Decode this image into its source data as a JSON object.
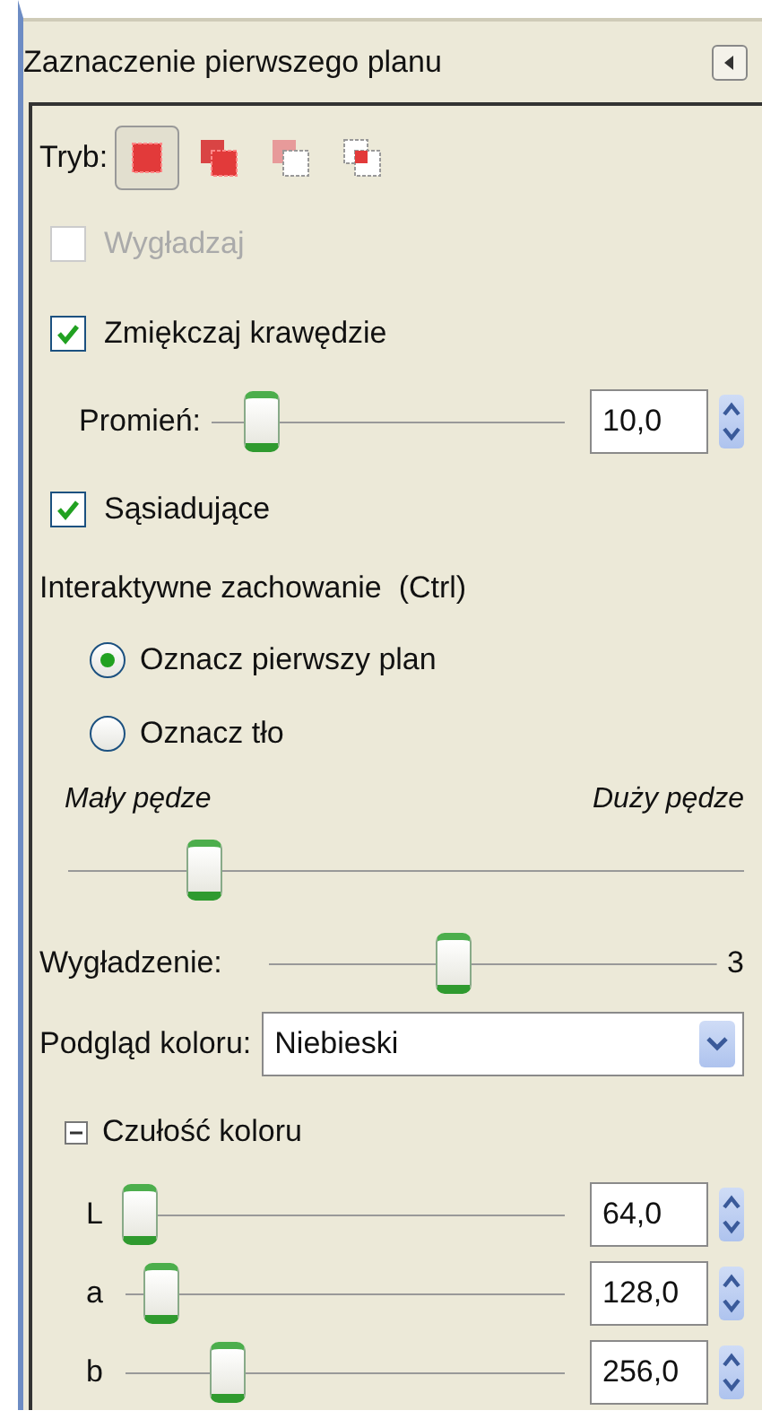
{
  "panel": {
    "title": "Zaznaczenie pierwszego planu"
  },
  "mode": {
    "label": "Tryb:",
    "options": [
      {
        "kind": "replace",
        "selected": true
      },
      {
        "kind": "add",
        "selected": false
      },
      {
        "kind": "subtract",
        "selected": false
      },
      {
        "kind": "intersect",
        "selected": false
      }
    ]
  },
  "antialias": {
    "label": "Wygładzaj",
    "checked": false,
    "disabled": true
  },
  "feather": {
    "label": "Zmiękczaj krawędzie",
    "checked": true,
    "disabled": false
  },
  "radius": {
    "label": "Promień:",
    "level": 0.1,
    "value": "10,0"
  },
  "contiguous": {
    "label": "Sąsiadujące",
    "checked": true,
    "disabled": false
  },
  "interactive": {
    "label": "Interaktywne zachowanie  (Ctrl)",
    "options": [
      {
        "label": "Oznacz pierwszy plan",
        "selected": true
      },
      {
        "label": "Oznacz tło",
        "selected": false
      }
    ]
  },
  "brush": {
    "min_label": "Mały pędze",
    "max_label": "Duży pędze",
    "level": 0.18
  },
  "smoothing": {
    "label": "Wygładzenie:",
    "level": 0.38,
    "value": "3"
  },
  "preview": {
    "label": "Podgląd koloru:",
    "value": "Niebieski"
  },
  "sensitivity": {
    "label": "Czułość koloru",
    "expanded": true,
    "channels": [
      {
        "name": "L",
        "level": 0.0,
        "value": "64,0"
      },
      {
        "name": "a",
        "level": 0.05,
        "value": "128,0"
      },
      {
        "name": "b",
        "level": 0.2,
        "value": "256,0"
      }
    ]
  }
}
